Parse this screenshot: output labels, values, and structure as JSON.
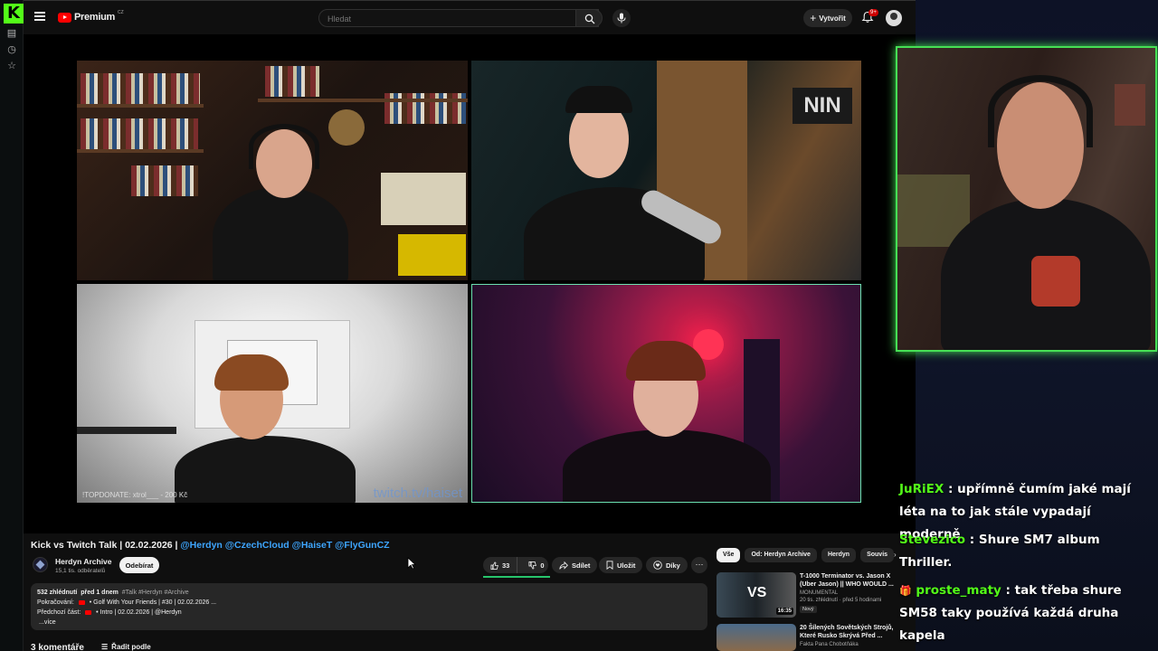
{
  "youtube": {
    "brand": "Premium",
    "region": "CZ",
    "search_placeholder": "Hledat",
    "create_label": "Vytvořit",
    "notif_count": "9+"
  },
  "video": {
    "donate_overlay": "!TOPDONATE: xtrol___ - 200 Kč",
    "twitch_watermark": "twitch.tv/haiset"
  },
  "details": {
    "title": "Kick vs Twitch Talk | 02.02.2026 |",
    "title_tags": "@Herdyn @CzechCloud @HaiseT @FlyGunCZ",
    "channel_name": "Herdyn Archive",
    "channel_subs": "15,1 tis. odběratelů",
    "subscribe_label": "Odebírat",
    "like_count": "33",
    "dislike_count": "0",
    "share_label": "Sdílet",
    "save_label": "Uložit",
    "thanks_label": "Díky",
    "desc_views": "532 zhlédnutí",
    "desc_date": "před 1 dnem",
    "desc_hashtags": "#Talk #Herdyn #Archive",
    "desc_next_label": "Pokračování:",
    "desc_next_value": "• Golf With Your Friends | #30 | 02.02.2026 ...",
    "desc_prev_label": "Předchozí část:",
    "desc_prev_value": "• Intro | 02.02.2026 | @Herdyn",
    "desc_more": "...více",
    "comments_count": "3 komentáře",
    "sort_label": "Řadit podle"
  },
  "chips": [
    "Vše",
    "Od: Herdyn Archive",
    "Herdyn",
    "Souvis"
  ],
  "recommendations": [
    {
      "title": "T-1000 Terminator vs. Jason X (Uber Jason) || WHO WOULD ...",
      "channel": "MONUMENTAL",
      "meta": "20 tis. zhlédnutí · před 5 hodinami",
      "badge": "Nový",
      "duration": "16:35",
      "thumb_text": "VS"
    },
    {
      "title": "20 Šílených Sovětských Strojů, Které Rusko Skrývá Před ...",
      "channel": "Fakta Pana Chobotňáka",
      "meta": "",
      "badge": "",
      "duration": "",
      "thumb_text": ""
    }
  ],
  "chat": [
    {
      "user": "JuRiEX",
      "message": "upřímně čumím jaké mají léta na to jak stále vypadají moderně"
    },
    {
      "user": "Stevezico",
      "message": "Shure SM7 album Thriller."
    },
    {
      "user": "proste_maty",
      "message": "tak třeba shure SM58 taky používá každá druha kapela",
      "badge_icon": "gift-icon"
    }
  ],
  "colors": {
    "kick_green": "#53fc18",
    "yt_red": "#ff0000",
    "link_blue": "#3ea6ff"
  }
}
